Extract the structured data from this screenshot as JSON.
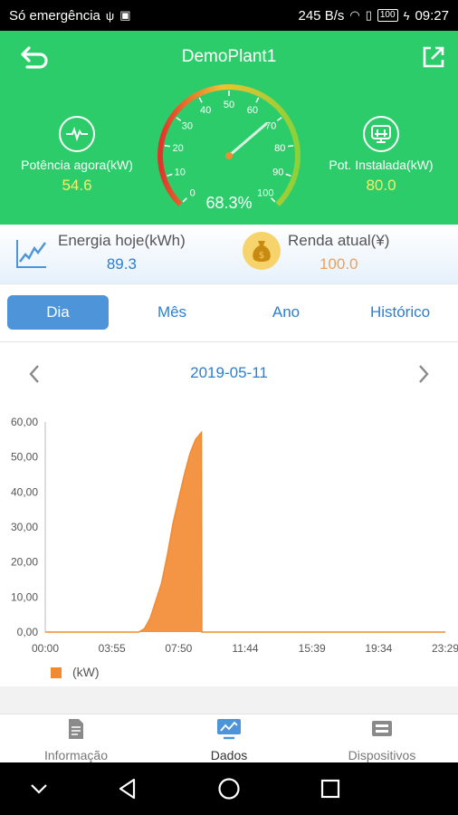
{
  "statusbar": {
    "carrier": "Só emergência",
    "speed": "245 B/s",
    "battery": "100",
    "time": "09:27"
  },
  "header": {
    "title": "DemoPlant1",
    "left_stat": {
      "label": "Potência agora(kW)",
      "value": "54.6",
      "icon": "pulse-icon"
    },
    "right_stat": {
      "label": "Pot. Instalada(kW)",
      "value": "80.0",
      "icon": "panel-icon"
    },
    "gauge": {
      "percent": 68.3,
      "percent_text": "68.3%",
      "ticks": [
        "0",
        "10",
        "20",
        "30",
        "40",
        "50",
        "60",
        "70",
        "80",
        "90",
        "100"
      ]
    }
  },
  "summary": {
    "energy_label": "Energia hoje(kWh)",
    "energy_value": "89.3",
    "income_label": "Renda atual(¥)",
    "income_value": "100.0"
  },
  "tabs": [
    "Dia",
    "Mês",
    "Ano",
    "Histórico"
  ],
  "active_tab": 0,
  "date": "2019-05-11",
  "chart_data": {
    "type": "area",
    "ylim": [
      0,
      60
    ],
    "y_ticks": [
      "0,00",
      "10,00",
      "20,00",
      "30,00",
      "40,00",
      "50,00",
      "60,00"
    ],
    "x_ticks": [
      "00:00",
      "03:55",
      "07:50",
      "11:44",
      "15:39",
      "19:34",
      "23:29"
    ],
    "x_range_hours": [
      0,
      23.5
    ],
    "series": [
      {
        "name": "(kW)",
        "color": "#f28a31",
        "x": [
          0,
          5.5,
          5.83,
          6.17,
          6.5,
          6.83,
          7.17,
          7.5,
          7.83,
          8.17,
          8.5,
          8.83,
          9.17,
          9.2,
          23.5
        ],
        "values": [
          0,
          0,
          1,
          4,
          9,
          14,
          22,
          31,
          38,
          45,
          51,
          55,
          57,
          0,
          0
        ]
      }
    ]
  },
  "bottomnav": [
    {
      "label": "Informação",
      "icon": "document-icon"
    },
    {
      "label": "Dados",
      "icon": "monitor-chart-icon"
    },
    {
      "label": "Dispositivos",
      "icon": "device-icon"
    }
  ],
  "active_nav": 1
}
